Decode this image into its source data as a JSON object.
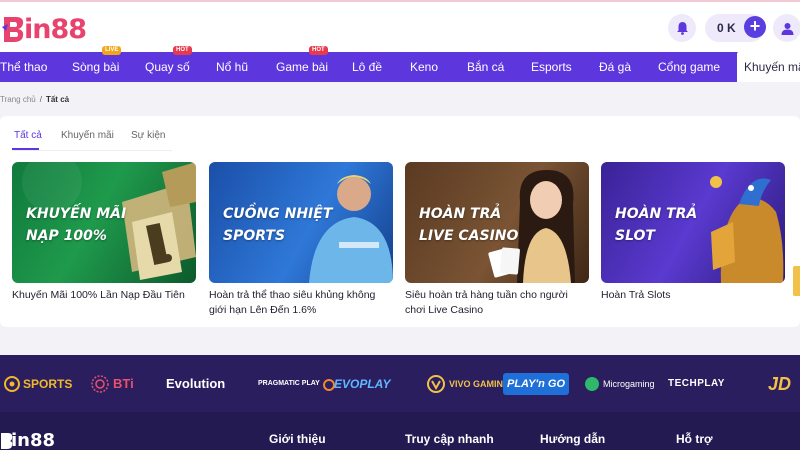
{
  "header": {
    "logo_text": "in88",
    "balance": "0 K",
    "plus_symbol": "+"
  },
  "nav": {
    "items": [
      {
        "label": "Thể thao"
      },
      {
        "label": "Sòng bài",
        "badge": "LIVE"
      },
      {
        "label": "Quay số",
        "badge": "HOT"
      },
      {
        "label": "Nổ hũ"
      },
      {
        "label": "Game bài",
        "badge": "HOT"
      },
      {
        "label": "Lô đề"
      },
      {
        "label": "Keno"
      },
      {
        "label": "Bắn cá"
      },
      {
        "label": "Esports"
      },
      {
        "label": "Đá gà"
      },
      {
        "label": "Cổng game"
      },
      {
        "label": "Khuyến mãi"
      }
    ],
    "active_index": 11
  },
  "breadcrumb": {
    "home": "Trang chủ",
    "separator": "/",
    "current": "Tất cả"
  },
  "tabs": [
    {
      "label": "Tất cả"
    },
    {
      "label": "Khuyến mãi"
    },
    {
      "label": "Sự kiện"
    }
  ],
  "cards": [
    {
      "img_line1": "KHUYẾN MÃI",
      "img_line2": "NẠP 100%",
      "caption": "Khuyến Mãi 100% Lần Nạp Đầu Tiên"
    },
    {
      "img_line1": "CUỒNG NHIỆT",
      "img_line2": "SPORTS",
      "caption": "Hoàn trả thể thao siêu khủng không giới hạn Lên Đến 1.6%"
    },
    {
      "img_line1": "HOÀN TRẢ",
      "img_line2": "LIVE CASINO",
      "caption": "Siêu hoàn trả hàng tuần cho người chơi Live Casino"
    },
    {
      "img_line1": "HOÀN TRẢ",
      "img_line2": "SLOT",
      "caption": "Hoàn Trả Slots"
    }
  ],
  "providers": [
    {
      "name": "SPORTS"
    },
    {
      "name": "BTi"
    },
    {
      "name": "Evolution"
    },
    {
      "name": "PRAGMATIC PLAY"
    },
    {
      "name": "EVOPLAY"
    },
    {
      "name": "VIVO GAMING"
    },
    {
      "name": "PLAY'n GO"
    },
    {
      "name": "Microgaming"
    },
    {
      "name": "TECHPLAY"
    },
    {
      "name": "JD"
    }
  ],
  "footer": {
    "logo_text": "in88",
    "columns": [
      "Giới thiệu",
      "Truy cập nhanh",
      "Hướng dẫn",
      "Hỗ trợ"
    ]
  },
  "colors": {
    "brand_purple": "#5d36dd",
    "logo_pink": "#e8436e",
    "footer_bg": "#231a52"
  }
}
